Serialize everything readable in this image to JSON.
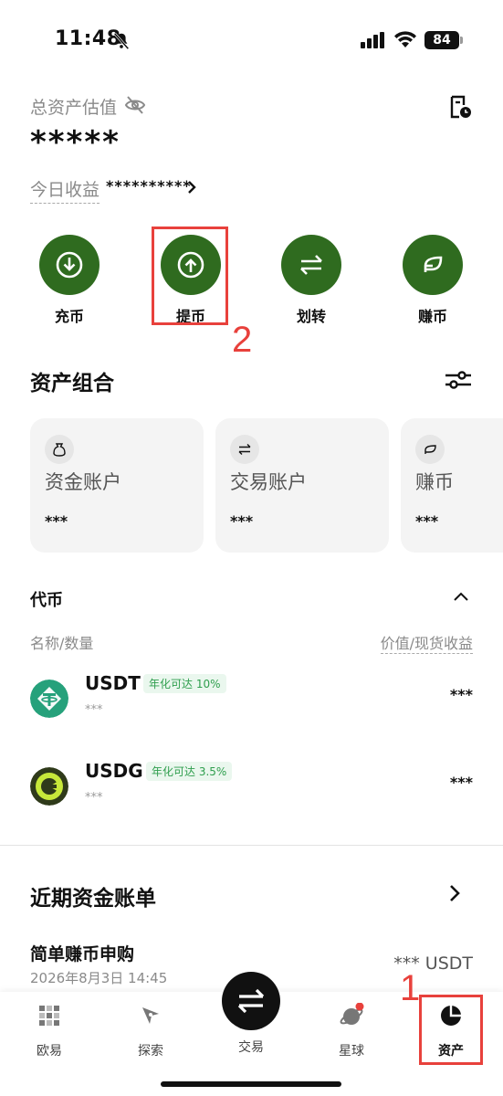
{
  "status_bar": {
    "time": "11:48",
    "battery": "84"
  },
  "header": {
    "total_label": "总资产估值",
    "total_value": "*****",
    "today_label": "今日收益",
    "today_value": "**********"
  },
  "actions": [
    {
      "label": "充币",
      "icon": "deposit-icon"
    },
    {
      "label": "提币",
      "icon": "withdraw-icon"
    },
    {
      "label": "划转",
      "icon": "transfer-icon"
    },
    {
      "label": "赚币",
      "icon": "earn-icon"
    }
  ],
  "annotations": {
    "step1": "1",
    "step2": "2",
    "color": "#e8413c"
  },
  "portfolio": {
    "title": "资产组合",
    "cards": [
      {
        "name": "资金账户",
        "value": "***",
        "icon": "money-bag-icon"
      },
      {
        "name": "交易账户",
        "value": "***",
        "icon": "swap-icon"
      },
      {
        "name": "赚币",
        "value": "***",
        "icon": "leaf-icon"
      }
    ]
  },
  "tokens": {
    "title": "代币",
    "col_left": "名称/数量",
    "col_right": "价值/现货收益",
    "items": [
      {
        "name": "USDT",
        "apy": "年化可达 10%",
        "sub": "***",
        "value": "***",
        "color": "#26a17b"
      },
      {
        "name": "USDG",
        "apy": "年化可达 3.5%",
        "sub": "***",
        "value": "***",
        "color": "#2f3a1a"
      }
    ]
  },
  "recent": {
    "title": "近期资金账单",
    "item_title": "简单赚币申购",
    "item_date": "2026年8月3日 14:45",
    "item_amount": "*** USDT"
  },
  "tabbar": {
    "tabs": [
      {
        "label": "欧易",
        "icon": "okx-icon"
      },
      {
        "label": "探索",
        "icon": "compass-icon"
      },
      {
        "label": "交易",
        "icon": "trade-icon"
      },
      {
        "label": "星球",
        "icon": "planet-icon"
      },
      {
        "label": "资产",
        "icon": "pie-icon"
      }
    ]
  },
  "colors": {
    "brand_green": "#2f6b1f",
    "apy_green": "#2e9e4d"
  }
}
